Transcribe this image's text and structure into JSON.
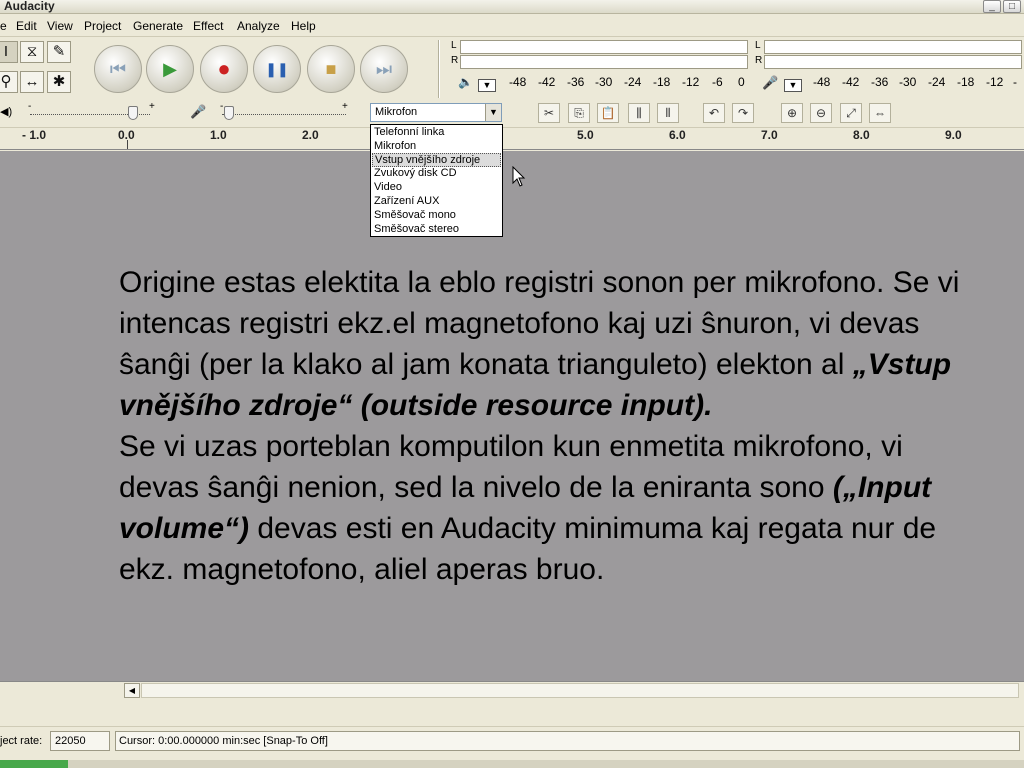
{
  "window": {
    "title": "Audacity"
  },
  "menu": [
    "e",
    "Edit",
    "View",
    "Project",
    "Generate",
    "Effect",
    "Analyze",
    "Help"
  ],
  "tools": {
    "select": "I",
    "envelope": "⧖",
    "draw": "✎",
    "zoom": "⚲",
    "timeshift": "↔",
    "multi": "✱"
  },
  "transport": {
    "skip_start": "⏮",
    "play": "▶",
    "record": "●",
    "pause": "❚❚",
    "stop": "■",
    "skip_end": "⏭"
  },
  "meters": {
    "left": "L",
    "right": "R",
    "scale": [
      "-48",
      "-42",
      "-36",
      "-30",
      "-24",
      "-18",
      "-12",
      "-6",
      "0"
    ],
    "scale_right": [
      "-48",
      "-42",
      "-36",
      "-30",
      "-24",
      "-18",
      "-12",
      "-"
    ]
  },
  "mixer": {
    "minus": "-",
    "plus": "+"
  },
  "input_source": {
    "selected": "Mikrofon",
    "options": [
      "Telefonní linka",
      "Mikrofon",
      "Vstup vnějšího zdroje",
      "Zvukový disk CD",
      "Video",
      "Zařízení AUX",
      "Směšovač mono",
      "Směšovač stereo"
    ],
    "highlighted_index": 2
  },
  "ruler": {
    "ticks": [
      "- 1.0",
      "0.0",
      "1.0",
      "2.0",
      "5.0",
      "6.0",
      "7.0",
      "8.0",
      "9.0"
    ]
  },
  "slide": {
    "p1_a": "Origine estas elektita la eblo registri sonon per mikrofono. Se vi intencas registri ekz.el magnetofono kaj uzi ŝnuron, vi devas ŝanĝi (per la klako al jam konata trianguleto) elekton al ",
    "p1_b": "„Vstup vnějšího zdroje“ (outside resource input).",
    "p2_a": "Se vi uzas porteblan komputilon kun enmetita mikrofono, vi devas ŝanĝi nenion, sed la nivelo de la eniranta sono ",
    "p2_b": "(„Input volume“)",
    "p2_c": " devas esti en Audacity minimuma kaj regata nur de ekz. magnetofono, aliel aperas bruo."
  },
  "status": {
    "rate_label": "ject rate:",
    "rate_value": "22050",
    "cursor": "Cursor: 0:00.000000 min:sec   [Snap-To Off]"
  }
}
